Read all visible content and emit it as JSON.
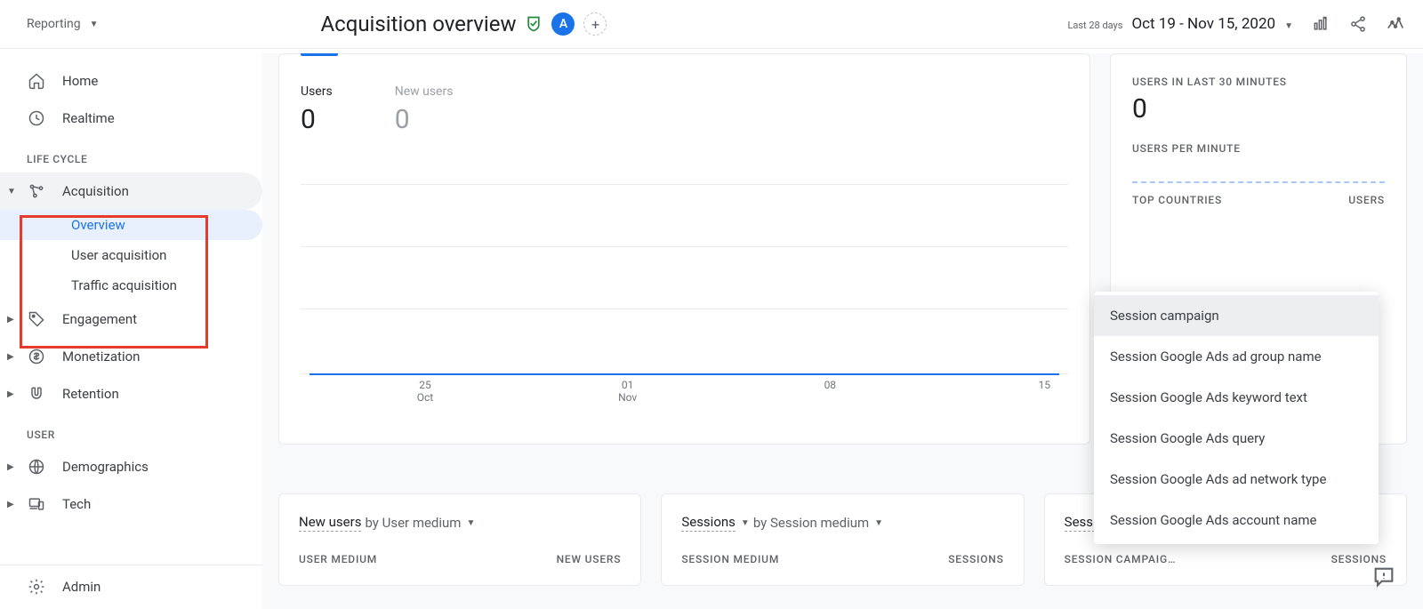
{
  "header": {
    "reporting_label": "Reporting",
    "page_title": "Acquisition overview",
    "avatar_letter": "A",
    "date_pre": "Last 28 days",
    "date_range": "Oct 19 - Nov 15, 2020"
  },
  "sidebar": {
    "home": "Home",
    "realtime": "Realtime",
    "section_life": "LIFE CYCLE",
    "acquisition": "Acquisition",
    "overview": "Overview",
    "user_acq": "User acquisition",
    "traffic_acq": "Traffic acquisition",
    "engagement": "Engagement",
    "monetization": "Monetization",
    "retention": "Retention",
    "section_user": "USER",
    "demographics": "Demographics",
    "tech": "Tech",
    "admin": "Admin"
  },
  "main_card": {
    "users_label": "Users",
    "users_value": "0",
    "newusers_label": "New users",
    "newusers_value": "0"
  },
  "chart_data": {
    "type": "line",
    "series": [
      {
        "name": "Users",
        "values": [
          0,
          0,
          0,
          0,
          0,
          0,
          0,
          0,
          0,
          0,
          0,
          0,
          0,
          0,
          0,
          0,
          0,
          0,
          0,
          0,
          0,
          0,
          0,
          0,
          0,
          0,
          0,
          0
        ]
      }
    ],
    "x_ticks": [
      {
        "major": "25",
        "minor": "Oct"
      },
      {
        "major": "01",
        "minor": "Nov"
      },
      {
        "major": "08",
        "minor": ""
      },
      {
        "major": "15",
        "minor": ""
      }
    ],
    "ylim": [
      0,
      1
    ]
  },
  "side_card": {
    "users30": "USERS IN LAST 30 MINUTES",
    "users30_val": "0",
    "upm": "USERS PER MINUTE",
    "top_countries": "TOP COUNTRIES",
    "users_col": "USERS"
  },
  "bottom": {
    "c1_bold": "New users",
    "c1_dim": "by User medium",
    "c1_left": "USER MEDIUM",
    "c1_right": "NEW USERS",
    "c2_bold": "Sessions",
    "c2_dim": "by Session medium",
    "c2_left": "SESSION MEDIUM",
    "c2_right": "SESSIONS",
    "c3_bold": "Sessions",
    "c3_left": "SESSION CAMPAIG…",
    "c3_right": "SESSIONS"
  },
  "dropdown": {
    "items": [
      "Session campaign",
      "Session Google Ads ad group name",
      "Session Google Ads keyword text",
      "Session Google Ads query",
      "Session Google Ads ad network type",
      "Session Google Ads account name"
    ]
  }
}
